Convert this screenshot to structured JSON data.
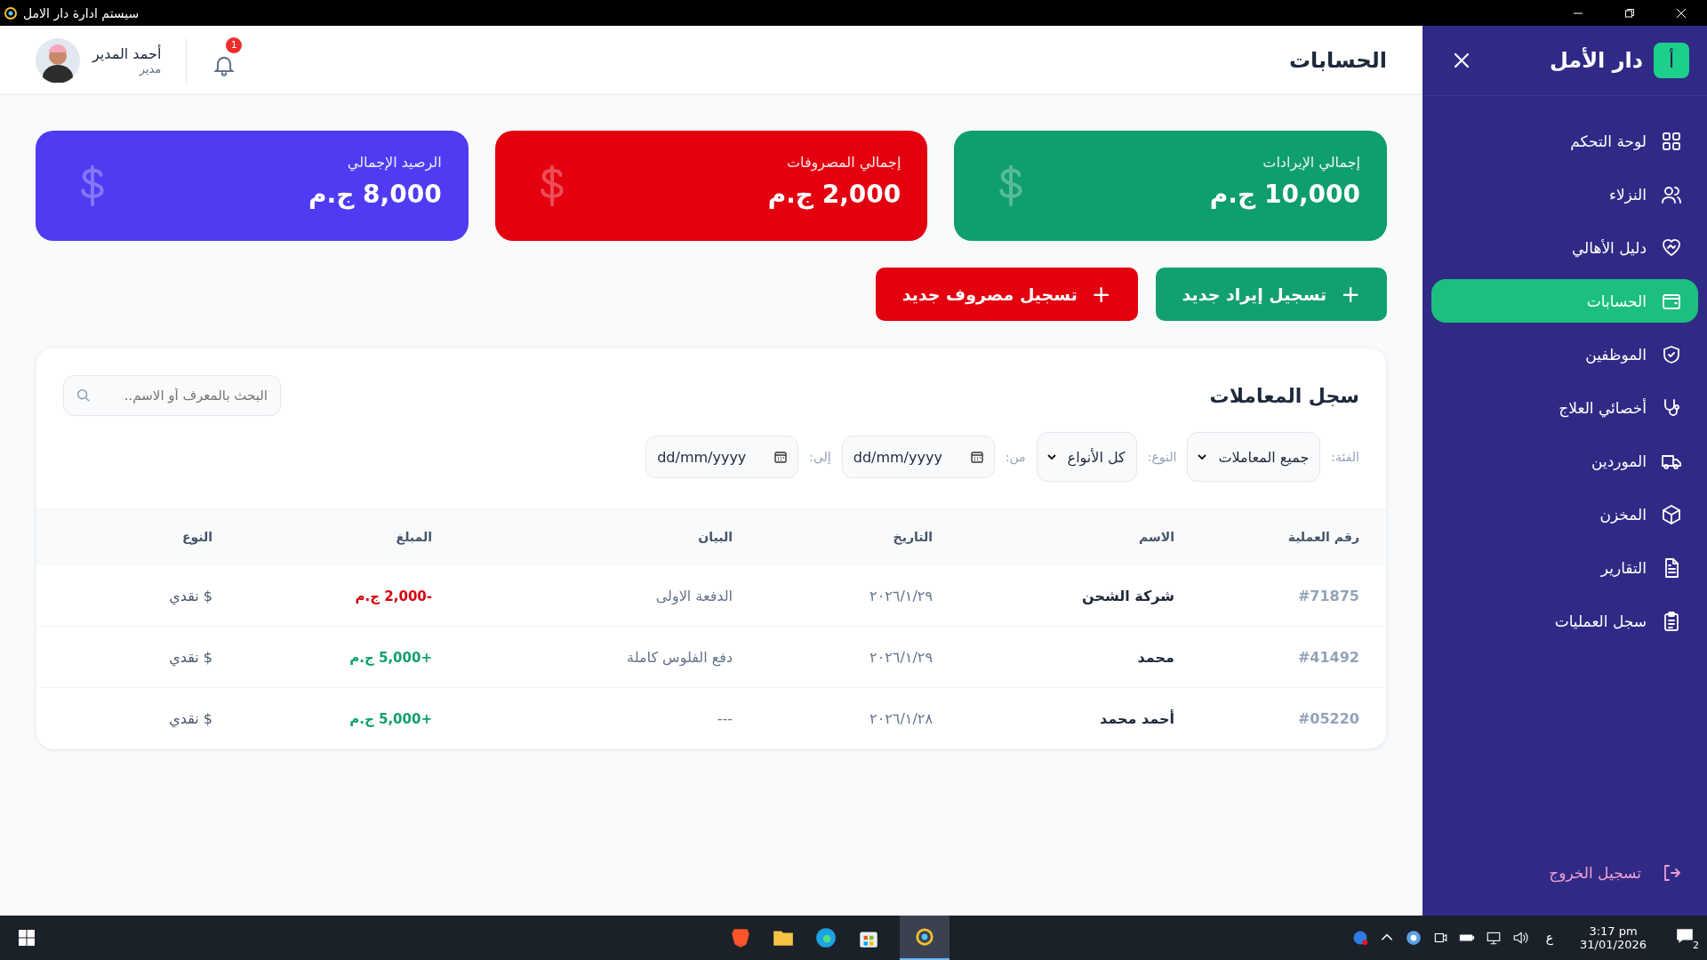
{
  "window": {
    "title": "سيستم ادارة دار الامل"
  },
  "sidebar": {
    "brand_letter": "أ",
    "brand": "دار الأمل",
    "items": [
      {
        "label": "لوحة التحكم",
        "selected": false
      },
      {
        "label": "النزلاء",
        "selected": false
      },
      {
        "label": "دليل الأهالي",
        "selected": false
      },
      {
        "label": "الحسابات",
        "selected": true
      },
      {
        "label": "الموظفين",
        "selected": false
      },
      {
        "label": "أخصائي العلاج",
        "selected": false
      },
      {
        "label": "الموردين",
        "selected": false
      },
      {
        "label": "المخزن",
        "selected": false
      },
      {
        "label": "التقارير",
        "selected": false
      },
      {
        "label": "سجل العمليات",
        "selected": false
      }
    ],
    "logout": "تسجيل الخروج"
  },
  "header": {
    "title": "الحسابات",
    "notifications": "1",
    "user": {
      "name": "أحمد المدير",
      "role": "مدير"
    }
  },
  "stats": [
    {
      "label": "إجمالي الإيرادات",
      "value": "10,000 ج.م",
      "kind": "income"
    },
    {
      "label": "إجمالي المصروفات",
      "value": "2,000 ج.م",
      "kind": "expense"
    },
    {
      "label": "الرصيد الإجمالي",
      "value": "8,000 ج.م",
      "kind": "balance"
    }
  ],
  "actions": [
    {
      "icon": "+",
      "label": "تسجيل إيراد جديد",
      "kind": "income"
    },
    {
      "icon": "+",
      "label": "تسجيل مصروف جديد",
      "kind": "expense"
    }
  ],
  "transactions": {
    "title": "سجل المعاملات",
    "search": {
      "placeholder": "البحث بالمعرف أو الاسم.."
    },
    "filters": [
      {
        "kind": "select",
        "label": "الفئة:",
        "value": "جميع المعاملات"
      },
      {
        "kind": "select",
        "label": "النوع:",
        "value": "كل الأنواع"
      },
      {
        "kind": "date",
        "label": "من:",
        "placeholder": "dd/mm/yyyy"
      },
      {
        "kind": "date",
        "label": "إلى:",
        "placeholder": "dd/mm/yyyy"
      }
    ],
    "columns": [
      "رقم العملية",
      "الاسم",
      "التاريخ",
      "البيان",
      "المبلغ",
      "النوع"
    ],
    "rows": [
      {
        "id": "#71875",
        "name": "شركة الشحن",
        "date": "٢٠٢٦/١/٢٩",
        "description": "الدفعة الاولى",
        "amount": "-2,000 ج.م",
        "kind": "expense",
        "type_icon": "$",
        "type": "نقدي"
      },
      {
        "id": "#41492",
        "name": "محمد",
        "date": "٢٠٢٦/١/٢٩",
        "description": "دفع الفلوس كاملة",
        "amount": "+5,000 ج.م",
        "kind": "income",
        "type_icon": "$",
        "type": "نقدي"
      },
      {
        "id": "#05220",
        "name": "أحمد محمد",
        "date": "٢٠٢٦/١/٢٨",
        "description": "---",
        "amount": "+5,000 ج.م",
        "kind": "income",
        "type_icon": "$",
        "type": "نقدي"
      }
    ]
  },
  "taskbar": {
    "language": "ع",
    "time": "3:17 pm",
    "date": "31/01/2026",
    "notifications": "2"
  }
}
